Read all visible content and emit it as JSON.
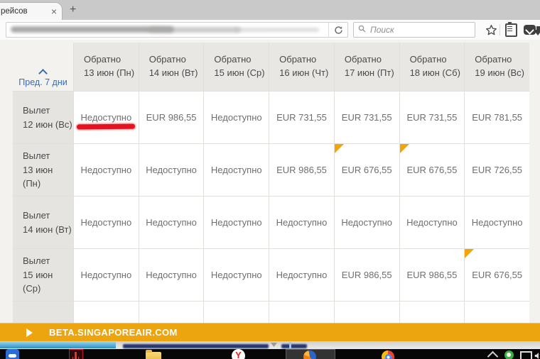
{
  "browser": {
    "tab_title": "рейсов",
    "close_glyph": "×",
    "new_tab_glyph": "+",
    "search_placeholder": "Поиск"
  },
  "fare_table": {
    "prev_link": "Пред. 7 дни",
    "unavailable_text": "Недоступно",
    "columns": [
      {
        "label": "Обратно",
        "date": "13  июн (Пн)"
      },
      {
        "label": "Обратно",
        "date": "14  июн (Вт)"
      },
      {
        "label": "Обратно",
        "date": "15  июн (Ср)"
      },
      {
        "label": "Обратно",
        "date": "16  июн (Чт)"
      },
      {
        "label": "Обратно",
        "date": "17  июн (Пт)"
      },
      {
        "label": "Обратно",
        "date": "18  июн (Сб)"
      },
      {
        "label": "Обратно",
        "date": "19  июн (Вс)"
      }
    ],
    "rows": [
      {
        "label": "Вылет",
        "date": "12  июн (Вс)",
        "cells": [
          {
            "v": "Недоступно",
            "mark": true
          },
          {
            "v": "EUR 986,55"
          },
          {
            "v": "Недоступно"
          },
          {
            "v": "EUR 731,55"
          },
          {
            "v": "EUR 731,55"
          },
          {
            "v": "EUR 731,55"
          },
          {
            "v": "EUR 781,55"
          }
        ]
      },
      {
        "label": "Вылет",
        "date": "13  июн (Пн)",
        "cells": [
          {
            "v": "Недоступно"
          },
          {
            "v": "Недоступно"
          },
          {
            "v": "Недоступно"
          },
          {
            "v": "EUR 986,55"
          },
          {
            "v": "EUR 676,55",
            "tri": true
          },
          {
            "v": "EUR 676,55",
            "tri": true
          },
          {
            "v": "EUR 726,55"
          }
        ]
      },
      {
        "label": "Вылет",
        "date": "14  июн (Вт)",
        "cells": [
          {
            "v": "Недоступно"
          },
          {
            "v": "Недоступно"
          },
          {
            "v": "Недоступно"
          },
          {
            "v": "Недоступно"
          },
          {
            "v": "Недоступно"
          },
          {
            "v": "Недоступно"
          },
          {
            "v": "Недоступно"
          }
        ]
      },
      {
        "label": "Вылет",
        "date": "15  июн (Ср)",
        "cells": [
          {
            "v": "Недоступно"
          },
          {
            "v": "Недоступно"
          },
          {
            "v": "Недоступно"
          },
          {
            "v": "Недоступно"
          },
          {
            "v": "EUR 986,55"
          },
          {
            "v": "EUR 986,55"
          },
          {
            "v": "EUR 676,55",
            "tri": true
          }
        ]
      },
      {
        "label": "",
        "date": "",
        "partial": true,
        "cells": [
          {
            "v": ""
          },
          {
            "v": ""
          },
          {
            "v": ""
          },
          {
            "v": ""
          },
          {
            "v": ""
          },
          {
            "v": ""
          },
          {
            "v": ""
          }
        ]
      }
    ]
  },
  "banner": {
    "text": "BETA.SINGAPOREAIR.COM"
  },
  "icons": {
    "close_tab": "×",
    "new_tab": "+",
    "reload": "circular-arrow",
    "search": "magnifier",
    "bookmark_star": "star-outline",
    "clipboard": "clipboard",
    "pocket": "pocket-chevron",
    "download": "down-arrow",
    "prev_caret": "chevron-up",
    "banner_play": "right-triangle",
    "lowest_fare_flag": "orange-corner-triangle",
    "red_marker": "marker-underline",
    "tray": [
      "chevron-up",
      "green-status",
      "network-monitor",
      "speaker"
    ],
    "taskbar_apps": [
      "teamviewer",
      "acrobat",
      "explorer-folder",
      "yandex-browser",
      "firefox",
      "chrome"
    ]
  },
  "colors": {
    "accent_orange": "#eca50f",
    "flag_orange": "#f0a50a",
    "marker_red": "#e5131f",
    "link_blue": "#2f6fc2",
    "header_gray": "#e9e7e3",
    "cell_text": "#6f6f6f"
  }
}
